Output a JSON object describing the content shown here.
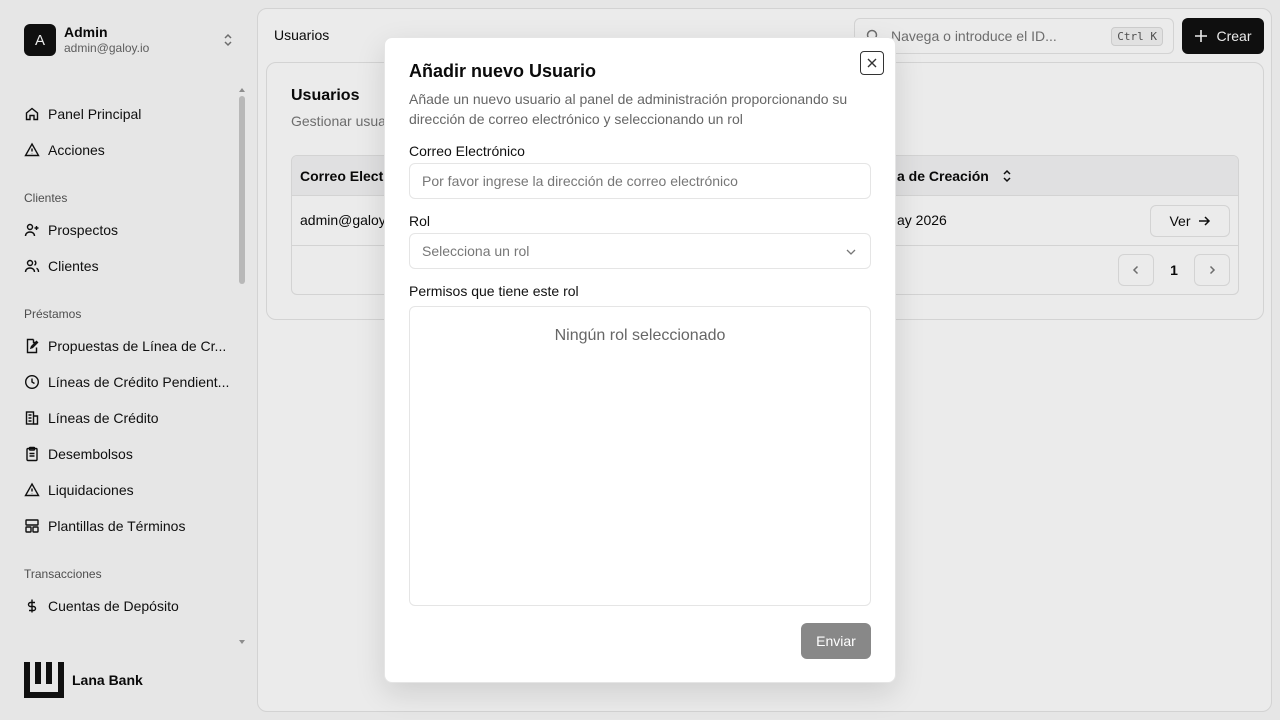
{
  "sidebar": {
    "user": {
      "initial": "A",
      "name": "Admin",
      "email": "admin@galoy.io"
    },
    "items_top": [
      {
        "label": "Panel Principal",
        "icon": "home-icon"
      },
      {
        "label": "Acciones",
        "icon": "alert-triangle-icon"
      }
    ],
    "sections": [
      {
        "title": "Clientes",
        "items": [
          {
            "label": "Prospectos",
            "icon": "user-plus-icon"
          },
          {
            "label": "Clientes",
            "icon": "users-icon"
          }
        ]
      },
      {
        "title": "Préstamos",
        "items": [
          {
            "label": "Propuestas de Línea de Cr...",
            "icon": "file-edit-icon"
          },
          {
            "label": "Líneas de Crédito Pendient...",
            "icon": "clock-icon"
          },
          {
            "label": "Líneas de Crédito",
            "icon": "building-icon"
          },
          {
            "label": "Desembolsos",
            "icon": "clipboard-icon"
          },
          {
            "label": "Liquidaciones",
            "icon": "alert-triangle-icon"
          },
          {
            "label": "Plantillas de Términos",
            "icon": "layout-template-icon"
          }
        ]
      },
      {
        "title": "Transacciones",
        "items": [
          {
            "label": "Cuentas de Depósito",
            "icon": "dollar-icon"
          }
        ]
      }
    ],
    "brand": "Lana Bank"
  },
  "header": {
    "title": "Usuarios",
    "search_placeholder": "Navega o introduce el ID...",
    "shortcut": "Ctrl K",
    "create_label": "Crear"
  },
  "card": {
    "title": "Usuarios",
    "subtitle": "Gestionar usuar",
    "columns": [
      "Correo Electró",
      "a de Creación"
    ],
    "rows": [
      {
        "email": "admin@galoy.",
        "created": "ay 2026",
        "action": "Ver"
      }
    ],
    "page": "1"
  },
  "modal": {
    "title": "Añadir nuevo Usuario",
    "description": "Añade un nuevo usuario al panel de administración proporcionando su dirección de correo electrónico y seleccionando un rol",
    "email_label": "Correo Electrónico",
    "email_placeholder": "Por favor ingrese la dirección de correo electrónico",
    "role_label": "Rol",
    "role_placeholder": "Selecciona un rol",
    "permissions_label": "Permisos que tiene este rol",
    "permissions_empty": "Ningún rol seleccionado",
    "submit_label": "Enviar"
  }
}
